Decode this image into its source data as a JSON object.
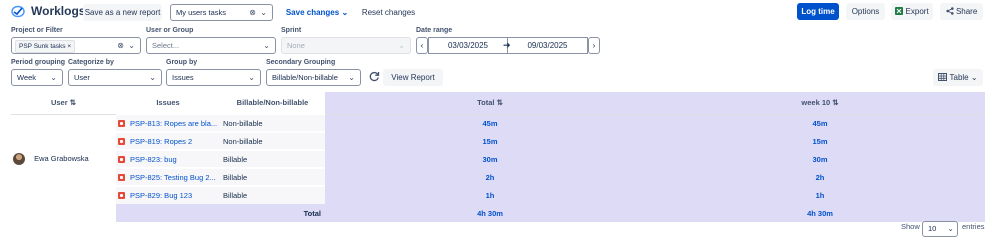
{
  "header": {
    "title": "Worklogs",
    "save_new_report": "Save as a new report",
    "report_select": "My users tasks",
    "save_changes": "Save changes",
    "reset_changes": "Reset changes",
    "log_time": "Log time",
    "options": "Options",
    "export": "Export",
    "share": "Share"
  },
  "filters": {
    "project_label": "Project or Filter",
    "project_tag": "PSP Sunk tasks",
    "user_group_label": "User or Group",
    "user_group_placeholder": "Select...",
    "sprint_label": "Sprint",
    "sprint_placeholder": "None",
    "date_range_label": "Date range",
    "date_from": "03/03/2025",
    "date_to": "09/03/2025",
    "period_label": "Period grouping",
    "period_value": "Week",
    "categorize_label": "Categorize by",
    "categorize_value": "User",
    "group_label": "Group by",
    "group_value": "Issues",
    "secondary_label": "Secondary Grouping",
    "secondary_value": "Billable/Non-billable",
    "view_report": "View Report",
    "view_mode": "Table"
  },
  "table": {
    "headers": {
      "user": "User",
      "issues": "Issues",
      "billable": "Billable/Non-billable",
      "total": "Total",
      "week": "week 10"
    },
    "user": "Ewa Grabowska",
    "rows": [
      {
        "issue": "PSP-813: Ropes are bla...",
        "billable": "Non-billable",
        "total": "45m",
        "week": "45m"
      },
      {
        "issue": "PSP-819: Ropes 2",
        "billable": "Non-billable",
        "total": "15m",
        "week": "15m"
      },
      {
        "issue": "PSP-823: bug",
        "billable": "Billable",
        "total": "30m",
        "week": "30m"
      },
      {
        "issue": "PSP-825: Testing Bug 2...",
        "billable": "Billable",
        "total": "2h",
        "week": "2h"
      },
      {
        "issue": "PSP-829: Bug 123",
        "billable": "Billable",
        "total": "1h",
        "week": "1h"
      }
    ],
    "total_label": "Total",
    "total_value": "4h 30m",
    "total_week": "4h 30m"
  },
  "footer": {
    "show_label": "Show",
    "entries_value": "10",
    "entries_label": "entries"
  },
  "colors": {
    "primary": "#0052cc",
    "highlight": "#dedbf7",
    "bug": "#e5493a"
  }
}
